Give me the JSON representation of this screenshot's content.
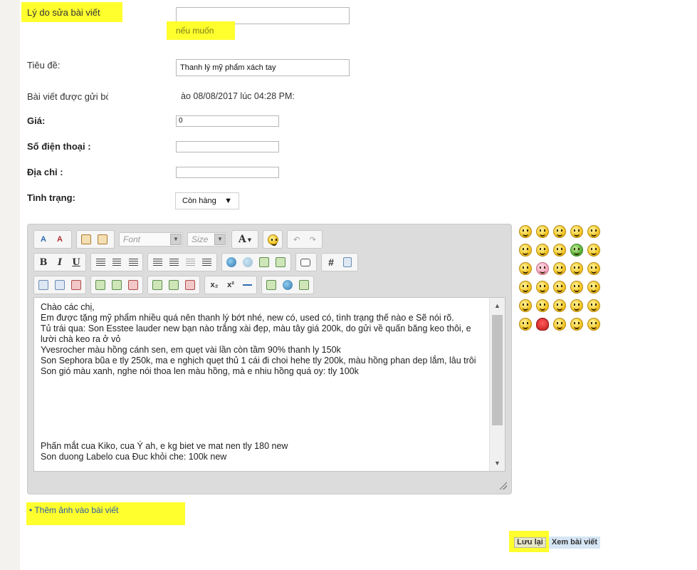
{
  "form": {
    "edit_reason_label": "Lý do sửa bài viết",
    "edit_reason_value": "",
    "edit_reason_hint": "nếu muốn",
    "title_label": "Tiêu đề:",
    "title_value": "Thanh lý mỹ phẩm xách tay",
    "posted_label": "Bài viết được gửi bởi",
    "posted_value": "ào 08/08/2017 lúc 04:28 PM:",
    "price_label": "Giá:",
    "price_value": "0",
    "phone_label": "Số điện thoại :",
    "phone_value": "",
    "address_label": "Địa chỉ :",
    "address_value": "",
    "status_label": "Tình trạng:",
    "status_value": "Còn hàng"
  },
  "editor": {
    "toolbar": {
      "font_placeholder": "Font",
      "size_placeholder": "Size",
      "font_color_glyph": "A",
      "bold": "B",
      "italic": "I",
      "underline": "U",
      "hash": "#",
      "subscript": "x₂",
      "superscript": "x²"
    },
    "content": [
      "Chào các chị,",
      "Em được tặng mỹ phẩm nhiều quá nên thanh lý bớt nhé, new có, used có, tình trạng thế nào e Sẽ nói rõ.",
      "Tủ trái qua: Son Esstee lauder new bạn nào trắng xài đẹp, màu tây giá 200k, do gửi về quấn băng keo thôi, e lười chà keo ra ở vỏ",
      "Yvesrocher màu hồng cánh sen, em quẹt vài lần còn tầm 90% thanh ly 150k",
      "Son Sephora bũa e tly 250k, ma e nghịch quẹt thủ 1 cái đi choi hehe tly 200k, màu hồng phan dep lắm, lâu trôi",
      "Son gió màu xanh, nghe nói thoa len màu hồng, mà e nhiu hồng quá oy: tly 100k",
      "Phấn mắt cua Kiko, cua Ý ah, e kg biet ve mat nen tly 180 new",
      "Son duong Labelo cua Đuc khỏi che: 100k new"
    ]
  },
  "smilies": [
    "smile-icon",
    "cool-icon",
    "grin-icon",
    "confused-icon",
    "laugh-icon",
    "tongue-icon",
    "sunglasses-icon",
    "wink-icon",
    "sick-icon",
    "blush-icon",
    "worried-icon",
    "pig-icon",
    "thinking-icon",
    "eek-icon",
    "biggrin-icon",
    "sad-icon",
    "mad-icon",
    "rolleyes-icon",
    "hmm-icon",
    "surprised-icon",
    "frown-icon",
    "shock-icon",
    "kiss-icon",
    "cry-icon",
    "angry-icon",
    "nerd-icon",
    "rose-icon",
    "happy-icon",
    "teeth-icon",
    "smirk-icon"
  ],
  "links": {
    "add_image": "• Thêm ảnh vào bài viết"
  },
  "buttons": {
    "save": "Lưu lại",
    "preview": "Xem bài viết"
  },
  "colors": {
    "highlight": "#ffff2e",
    "link": "#2a5aa8",
    "preview_bg": "#d6e6f5"
  }
}
